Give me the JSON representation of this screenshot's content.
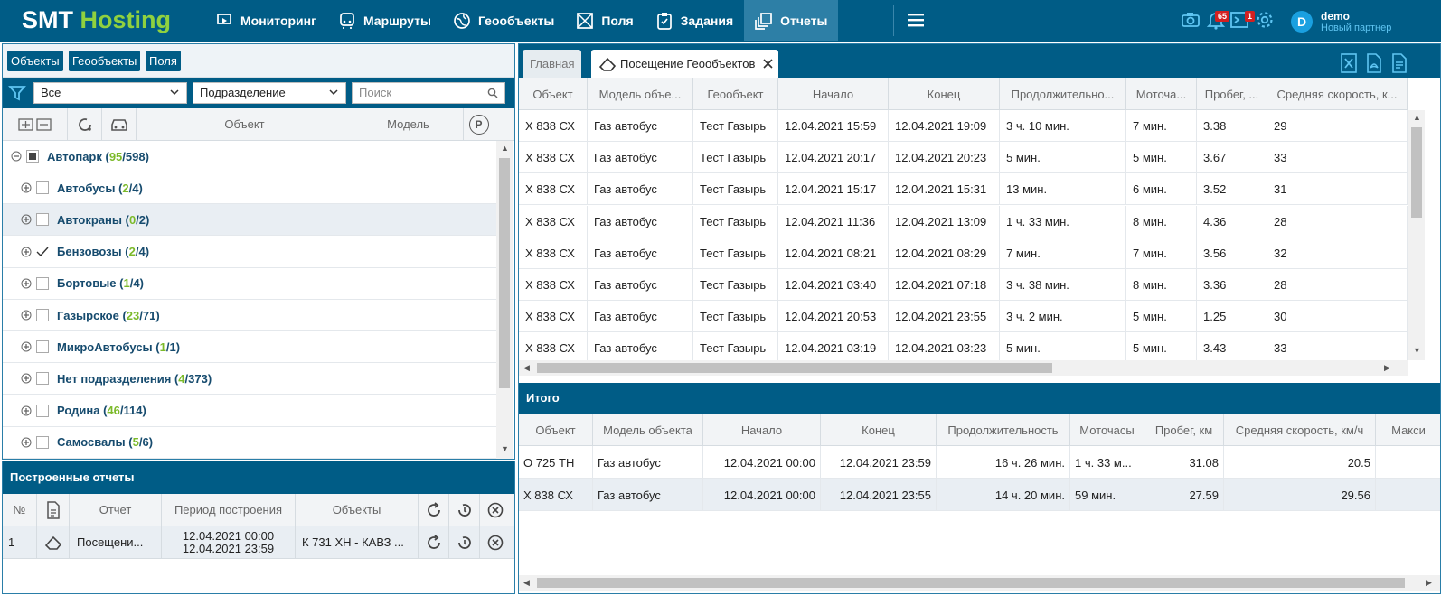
{
  "app": {
    "logo_a": "SMT",
    "logo_b": "Hosting",
    "nav": [
      "Мониторинг",
      "Маршруты",
      "Геообъекты",
      "Поля",
      "Задания",
      "Отчеты"
    ],
    "active_nav": "Отчеты",
    "notifications_badge": "65",
    "messages_badge": "1",
    "user_initial": "D",
    "user_name": "demo",
    "user_role": "Новый партнер",
    "brand_color": "#005c86",
    "accent_color": "#8fd13f"
  },
  "left": {
    "tabs": [
      "Объекты",
      "Геообъекты",
      "Поля"
    ],
    "filter_select": "Все",
    "division_select": "Подразделение",
    "search_placeholder": "Поиск",
    "col_object": "Объект",
    "col_model": "Модель",
    "parking_label": "P",
    "tree": [
      {
        "name": "Автопарк",
        "a": "95",
        "b": "598",
        "level": 0,
        "check": "partial"
      },
      {
        "name": "Автобусы",
        "a": "2",
        "b": "4",
        "level": 1,
        "check": "none"
      },
      {
        "name": "Автокраны",
        "a": "0",
        "b": "2",
        "level": 1,
        "check": "none",
        "selected": true
      },
      {
        "name": "Бензовозы",
        "a": "2",
        "b": "4",
        "level": 1,
        "check": "checked"
      },
      {
        "name": "Бортовые",
        "a": "1",
        "b": "4",
        "level": 1,
        "check": "none"
      },
      {
        "name": "Газырское",
        "a": "23",
        "b": "71",
        "level": 1,
        "check": "none"
      },
      {
        "name": "МикроАвтобусы",
        "a": "1",
        "b": "1",
        "level": 1,
        "check": "none"
      },
      {
        "name": "Нет подразделения",
        "a": "4",
        "b": "373",
        "level": 1,
        "check": "none"
      },
      {
        "name": "Родина",
        "a": "46",
        "b": "114",
        "level": 1,
        "check": "none"
      },
      {
        "name": "Самосвалы",
        "a": "5",
        "b": "6",
        "level": 1,
        "check": "none"
      }
    ]
  },
  "reports": {
    "title": "Построенные отчеты",
    "col_num": "№",
    "col_report": "Отчет",
    "col_period": "Период построения",
    "col_objects": "Объекты",
    "row": {
      "num": "1",
      "report": "Посещени...",
      "period_from": "12.04.2021 00:00",
      "period_to": "12.04.2021 23:59",
      "objects": "К 731 ХН - КАВЗ ..."
    }
  },
  "right": {
    "tab_home": "Главная",
    "tab_current": "Посещение Геообъектов",
    "columns": [
      "Объект",
      "Модель объе...",
      "Геообъект",
      "Начало",
      "Конец",
      "Продолжительно...",
      "Моточа...",
      "Пробег, ...",
      "Средняя скорость, к..."
    ],
    "rows": [
      [
        "Х 838 СХ",
        "Газ автобус",
        "Тест Газырь",
        "12.04.2021 15:59",
        "12.04.2021 19:09",
        "3 ч. 10 мин.",
        "7 мин.",
        "3.38",
        "29"
      ],
      [
        "Х 838 СХ",
        "Газ автобус",
        "Тест Газырь",
        "12.04.2021 20:17",
        "12.04.2021 20:23",
        "5 мин.",
        "5 мин.",
        "3.67",
        "33"
      ],
      [
        "Х 838 СХ",
        "Газ автобус",
        "Тест Газырь",
        "12.04.2021 15:17",
        "12.04.2021 15:31",
        "13 мин.",
        "6 мин.",
        "3.52",
        "31"
      ],
      [
        "Х 838 СХ",
        "Газ автобус",
        "Тест Газырь",
        "12.04.2021 11:36",
        "12.04.2021 13:09",
        "1 ч. 33 мин.",
        "8 мин.",
        "4.36",
        "28"
      ],
      [
        "Х 838 СХ",
        "Газ автобус",
        "Тест Газырь",
        "12.04.2021 08:21",
        "12.04.2021 08:29",
        "7 мин.",
        "7 мин.",
        "3.56",
        "32"
      ],
      [
        "Х 838 СХ",
        "Газ автобус",
        "Тест Газырь",
        "12.04.2021 03:40",
        "12.04.2021 07:18",
        "3 ч. 38 мин.",
        "8 мин.",
        "3.36",
        "28"
      ],
      [
        "Х 838 СХ",
        "Газ автобус",
        "Тест Газырь",
        "12.04.2021 20:53",
        "12.04.2021 23:55",
        "3 ч. 2 мин.",
        "5 мин.",
        "1.25",
        "30"
      ],
      [
        "Х 838 СХ",
        "Газ автобус",
        "Тест Газырь",
        "12.04.2021 03:19",
        "12.04.2021 03:23",
        "5 мин.",
        "5 мин.",
        "3.43",
        "33"
      ]
    ],
    "summary_title": "Итого",
    "summary_columns": [
      "Объект",
      "Модель объекта",
      "Начало",
      "Конец",
      "Продолжительность",
      "Моточасы",
      "Пробег, км",
      "Средняя скорость, км/ч",
      "Макси"
    ],
    "summary_rows": [
      [
        "О 725 ТН",
        "Газ автобус",
        "12.04.2021 00:00",
        "12.04.2021 23:59",
        "16 ч. 26 мин.",
        "1 ч. 33 м...",
        "31.08",
        "20.5",
        ""
      ],
      [
        "Х 838 СХ",
        "Газ автобус",
        "12.04.2021 00:00",
        "12.04.2021 23:55",
        "14 ч. 20 мин.",
        "59 мин.",
        "27.59",
        "29.56",
        ""
      ]
    ]
  }
}
